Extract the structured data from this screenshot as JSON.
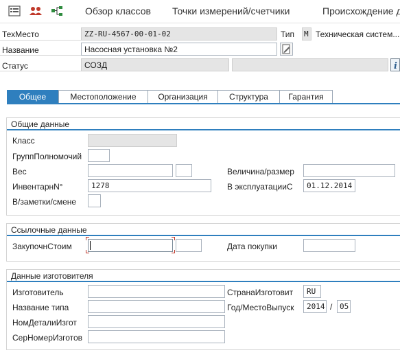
{
  "toolbar": {
    "buttons": [
      {
        "icon": "list-icon"
      },
      {
        "icon": "users-icon"
      },
      {
        "icon": "hierarchy-icon"
      }
    ],
    "links": [
      "Обзор классов",
      "Точки измерений/счетчики",
      "Происхождение д"
    ]
  },
  "header": {
    "techplace_label": "ТехМесто",
    "techplace_value": "ZZ-RU-4567-00-01-02",
    "type_label": "Тип",
    "type_code": "M",
    "type_text": "Техническая систем...",
    "name_label": "Название",
    "name_value": "Насосная установка №2",
    "status_label": "Статус",
    "status_value": "СОЗД"
  },
  "tabs": [
    "Общее",
    "Местоположение",
    "Организация",
    "Структура",
    "Гарантия"
  ],
  "general": {
    "title": "Общие данные",
    "class_label": "Класс",
    "class_value": "",
    "authgroup_label": "ГруппПолномочий",
    "authgroup_value": "",
    "weight_label": "Вес",
    "weight_value": "",
    "weight_unit": "",
    "size_label": "Величина/размер",
    "size_value": "",
    "inventory_label": "ИнвентарнN°",
    "inventory_value": "1278",
    "startup_label": "В эксплуатацииС",
    "startup_value": "01.12.2014",
    "shift_label": "В/заметки/смене",
    "shift_value": ""
  },
  "reference": {
    "title": "Ссылочные данные",
    "cost_label": "ЗакупочнСтоим",
    "cost_value": "",
    "currency_value": "",
    "purchase_date_label": "Дата покупки",
    "purchase_date_value": ""
  },
  "manufacturer": {
    "title": "Данные изготовителя",
    "maker_label": "Изготовитель",
    "maker_value": "",
    "country_label": "СтранаИзготовит",
    "country_value": "RU",
    "model_label": "Название типа",
    "model_value": "",
    "year_label": "Год/МестоВыпуск",
    "year_value": "2014",
    "year_sep": "/",
    "month_value": "05",
    "partno_label": "НомДеталиИзгот",
    "partno_value": "",
    "serial_label": "СерНомерИзготов",
    "serial_value": ""
  },
  "colors": {
    "accent": "#2f7fbe",
    "readonly": "#e5e5e5"
  }
}
